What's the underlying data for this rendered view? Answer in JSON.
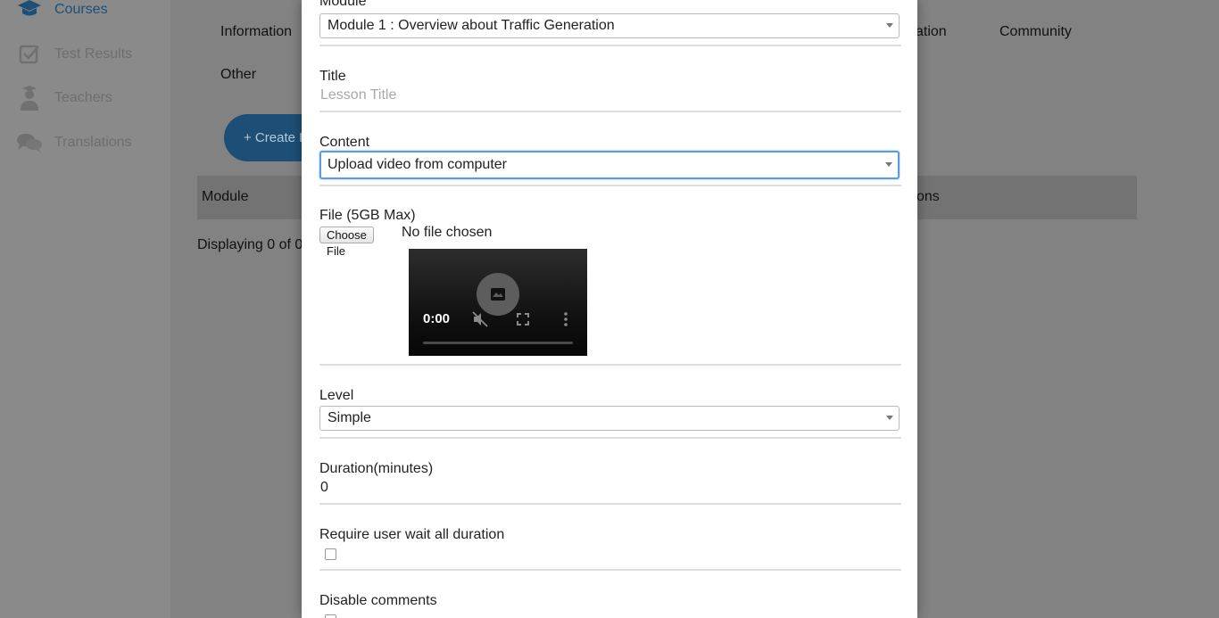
{
  "sidebar": {
    "items": [
      {
        "label": "Courses",
        "icon": "graduation-cap-icon",
        "active": true
      },
      {
        "label": "Test Results",
        "icon": "checkbox-icon"
      },
      {
        "label": "Teachers",
        "icon": "teacher-icon"
      },
      {
        "label": "Translations",
        "icon": "chat-bubbles-icon"
      }
    ]
  },
  "background": {
    "tabs": {
      "information": "Information",
      "ation": "ation",
      "community": "Community",
      "other": "Other"
    },
    "create_button": "+ Create L",
    "table": {
      "col_module": "Module",
      "col_ons": "ons"
    },
    "displaying": "Displaying 0 of 0"
  },
  "modal": {
    "module": {
      "label": "Module",
      "value": "Module 1 : Overview about Traffic Generation"
    },
    "title": {
      "label": "Title",
      "placeholder": "Lesson Title"
    },
    "content": {
      "label": "Content",
      "value": "Upload video from computer"
    },
    "file": {
      "label": "File (5GB Max)",
      "button": "Choose File",
      "status": "No file chosen"
    },
    "video": {
      "time": "0:00"
    },
    "level": {
      "label": "Level",
      "value": "Simple"
    },
    "duration": {
      "label": "Duration(minutes)",
      "value": "0"
    },
    "require_wait": {
      "label": "Require user wait all duration",
      "checked": false
    },
    "disable_comments": {
      "label": "Disable comments",
      "checked": false
    }
  },
  "colors": {
    "accent": "#1d4f76",
    "focus_border": "#5a9ae6",
    "overlay": "#828282"
  }
}
